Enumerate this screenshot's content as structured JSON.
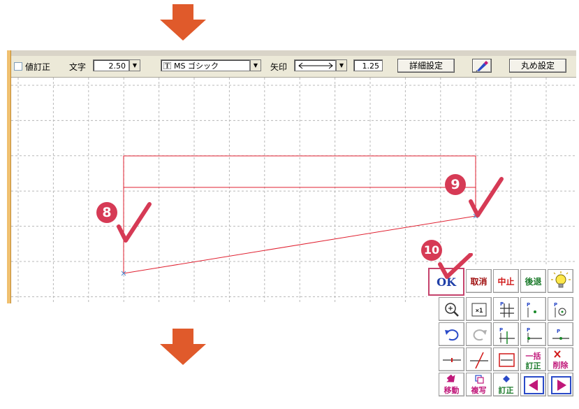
{
  "toolbar": {
    "checkbox_label": "値訂正",
    "text_label": "文字",
    "text_size": "2.50",
    "font_name": "MS ゴシック",
    "arrow_label": "矢印",
    "arrow_size": "1.25",
    "detail_button": "詳細設定",
    "round_button": "丸め設定"
  },
  "steps": {
    "s8": "8",
    "s9": "9",
    "s10": "10"
  },
  "palette": {
    "row1": {
      "ok": "OK",
      "cancel": "取消",
      "stop": "中止",
      "back": "後退"
    },
    "row4": {
      "bulk_correct_top": "一括",
      "bulk_correct_bottom": "訂正",
      "delete": "削除"
    },
    "row5": {
      "move": "移動",
      "copy": "複写",
      "correct": "訂正"
    }
  },
  "colors": {
    "accent_orange": "#e05a2b",
    "step_badge": "#d63a55",
    "drawing_line": "#e02030",
    "ok_text": "#1f3fa8",
    "cancel_text": "#a01010",
    "stop_text": "#d01818",
    "back_text": "#1a7a2a",
    "label_magenta": "#c0187a"
  }
}
